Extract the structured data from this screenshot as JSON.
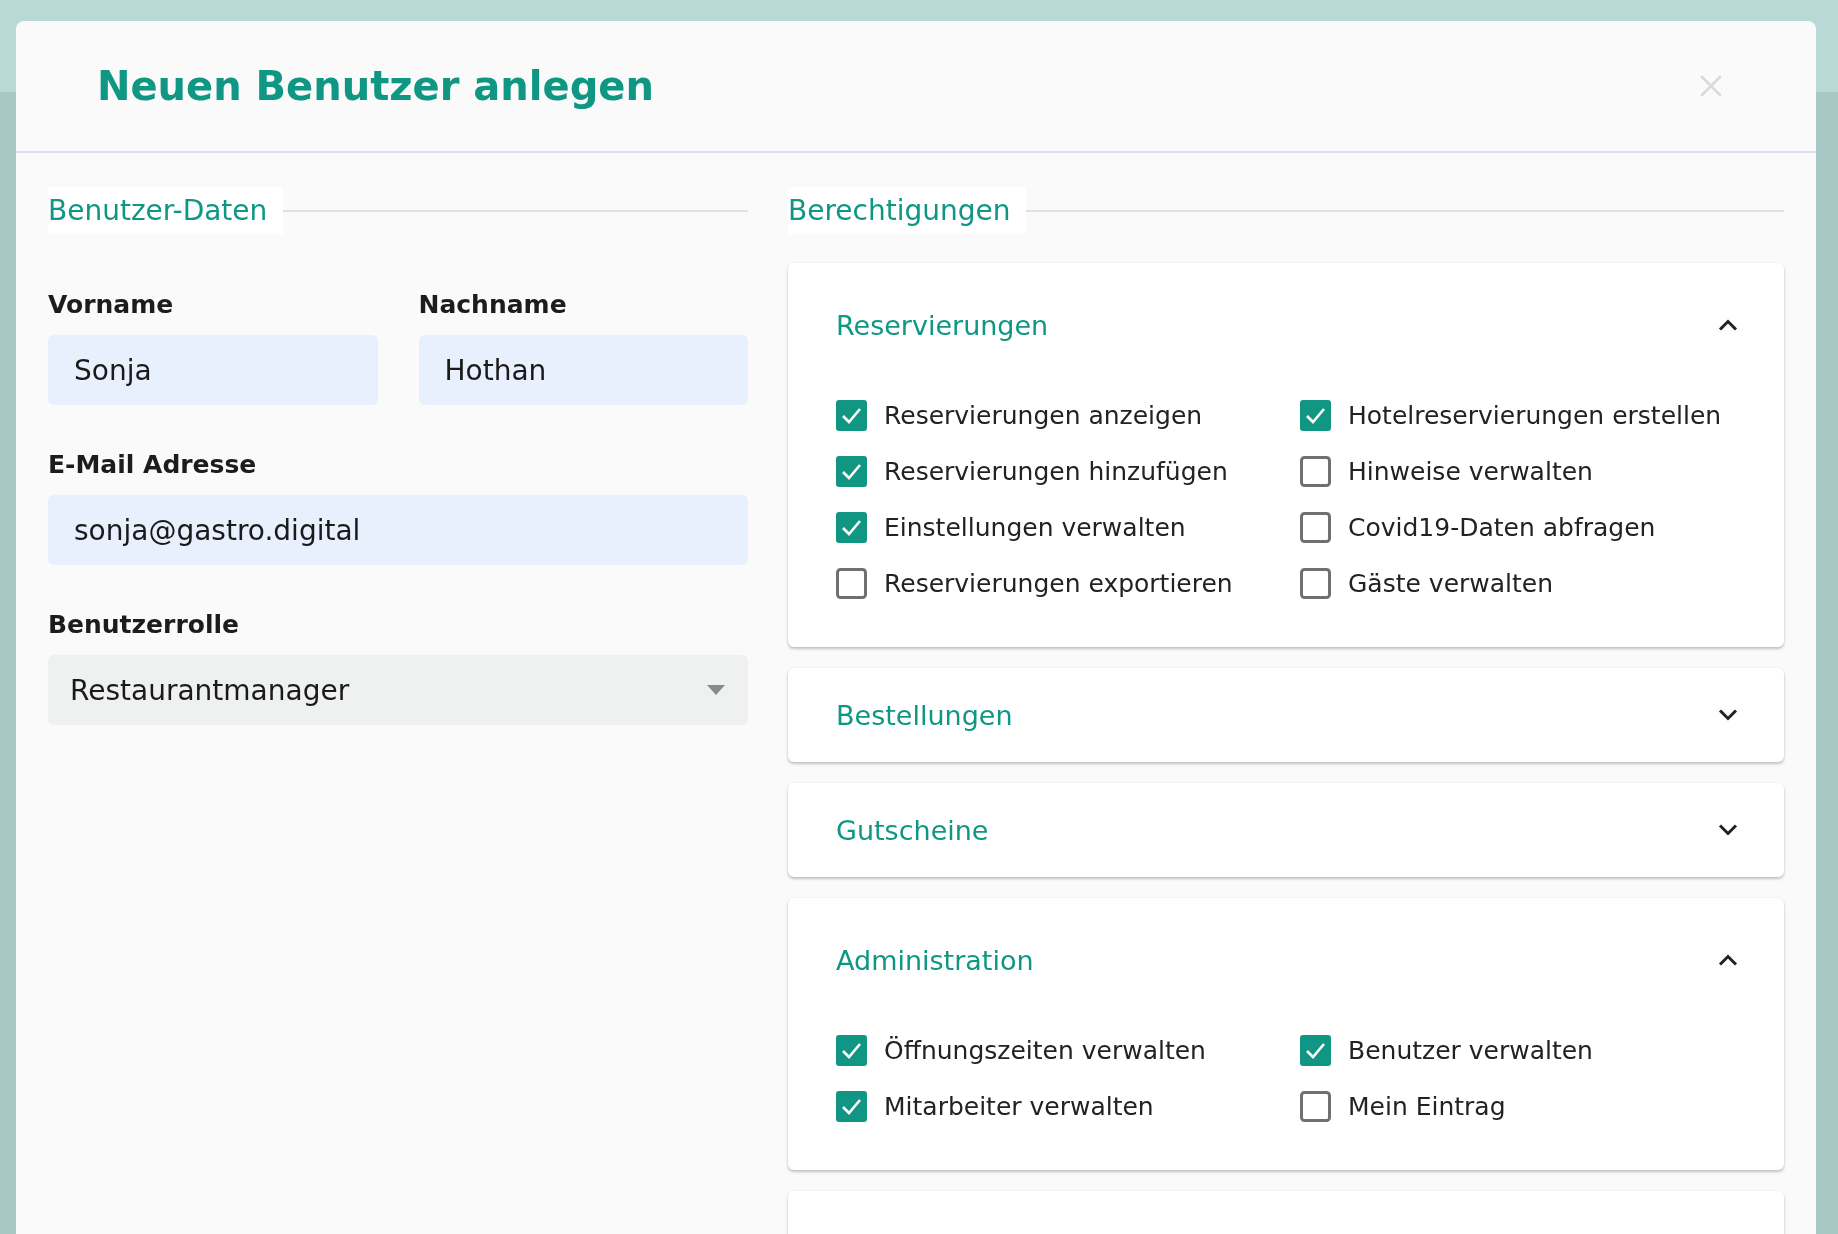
{
  "dialog": {
    "title": "Neuen Benutzer anlegen"
  },
  "user_data": {
    "heading": "Benutzer-Daten",
    "field_rows": [
      [
        {
          "kind": "text",
          "label": "Vorname",
          "value": "Sonja"
        },
        {
          "kind": "text",
          "label": "Nachname",
          "value": "Hothan"
        }
      ],
      [
        {
          "kind": "text",
          "label": "E-Mail Adresse",
          "value": "sonja@gastro.digital"
        }
      ],
      [
        {
          "kind": "select",
          "label": "Benutzerrolle",
          "value": "Restaurantmanager"
        }
      ]
    ]
  },
  "permissions": {
    "heading": "Berechtigungen",
    "groups": [
      {
        "title": "Reservierungen",
        "expanded": true,
        "items": [
          {
            "label": "Reservierungen anzeigen",
            "checked": true
          },
          {
            "label": "Hotelreservierungen erstellen",
            "checked": true
          },
          {
            "label": "Reservierungen hinzufügen",
            "checked": true
          },
          {
            "label": "Hinweise verwalten",
            "checked": false
          },
          {
            "label": "Einstellungen verwalten",
            "checked": true
          },
          {
            "label": "Covid19-Daten abfragen",
            "checked": false
          },
          {
            "label": "Reservierungen exportieren",
            "checked": false
          },
          {
            "label": "Gäste verwalten",
            "checked": false
          }
        ]
      },
      {
        "title": "Bestellungen",
        "expanded": false
      },
      {
        "title": "Gutscheine",
        "expanded": false
      },
      {
        "title": "Administration",
        "expanded": true,
        "items": [
          {
            "label": "Öffnungszeiten verwalten",
            "checked": true
          },
          {
            "label": "Benutzer verwalten",
            "checked": true
          },
          {
            "label": "Mitarbeiter verwalten",
            "checked": true
          },
          {
            "label": "Mein Eintrag",
            "checked": false
          }
        ]
      }
    ]
  }
}
